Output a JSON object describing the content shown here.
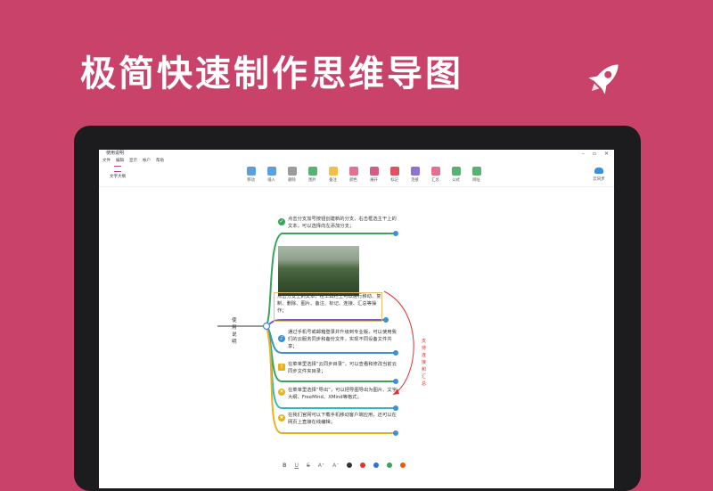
{
  "banner": {
    "headline": "极简快速制作思维导图",
    "icon": "rocket-icon"
  },
  "window": {
    "title": "使用说明",
    "menu": [
      "文件",
      "编辑",
      "显示",
      "帐户",
      "帮助"
    ],
    "controls": [
      "–",
      "▫",
      "✕"
    ]
  },
  "toolbar": {
    "outline_label": "文字大纲",
    "tools": [
      {
        "label": "移动",
        "icon": "move-icon",
        "color": "#3d8fd6"
      },
      {
        "label": "插入",
        "icon": "insert-icon",
        "color": "#3d8fd6"
      },
      {
        "label": "删除",
        "icon": "delete-icon",
        "color": "#8a8a8a"
      },
      {
        "label": "图片",
        "icon": "image-icon",
        "color": "#3aa55a"
      },
      {
        "label": "备注",
        "icon": "note-icon",
        "color": "#f0b429"
      },
      {
        "label": "颜色",
        "icon": "palette-icon",
        "color": "#e0567d"
      },
      {
        "label": "展开",
        "icon": "expand-icon",
        "color": "#c9426a"
      },
      {
        "label": "标记",
        "icon": "flag-icon",
        "color": "#d8334a"
      },
      {
        "label": "连接",
        "icon": "connect-icon",
        "color": "#7a5cc7"
      },
      {
        "label": "汇总",
        "icon": "summary-icon",
        "color": "#e0567d"
      },
      {
        "label": "公式",
        "icon": "formula-icon",
        "color": "#3aa55a"
      },
      {
        "label": "网址",
        "icon": "link-icon",
        "color": "#3aa55a"
      }
    ],
    "sync_label": "云同步"
  },
  "mindmap": {
    "root": "使用说明",
    "branches": [
      {
        "text": "点击分支加号按钮创建新的分支，右击框选主干上的文本，可以选择向左添加分支；",
        "icon": "check-icon",
        "color": "#3aa55a"
      },
      {
        "text": "点击分支上的文本，在工具栏上可以进行移动、复制、删除、图片、备注、标记、连接、汇总等操作；",
        "icon": "",
        "color": "#7a5cc7"
      },
      {
        "text": "通过手机号或邮箱登录并升级到专业版，可以使用我们的云服务同步和备份文件，实现不同设备文件共享；",
        "icon": "bell-icon",
        "color": "#3d8fd6"
      },
      {
        "text": "在菜单里选择“云同步目录”，可以查看和修改当前云同步文件夹目录；",
        "icon": "warning-icon",
        "color": "#3aa55a"
      },
      {
        "text": "在菜单里选择“导出”，可以把导图导出为图片、文字大纲、FreeMind、XMind等格式；",
        "icon": "idea-icon",
        "color": "#2fb7c9"
      },
      {
        "text": "在我们官网可以下载手机移动客户端应用，还可以在网页上直接在线编辑；",
        "icon": "star-icon",
        "color": "#e6b31e"
      }
    ],
    "connection_label": "支持连接和汇总"
  },
  "formatbar": {
    "buttons": [
      "B",
      "U",
      "S",
      "A⁺",
      "A⁻"
    ],
    "colors": [
      "#333333",
      "#e03131",
      "#2f6fde",
      "#3aa55a",
      "#e8590c"
    ]
  }
}
